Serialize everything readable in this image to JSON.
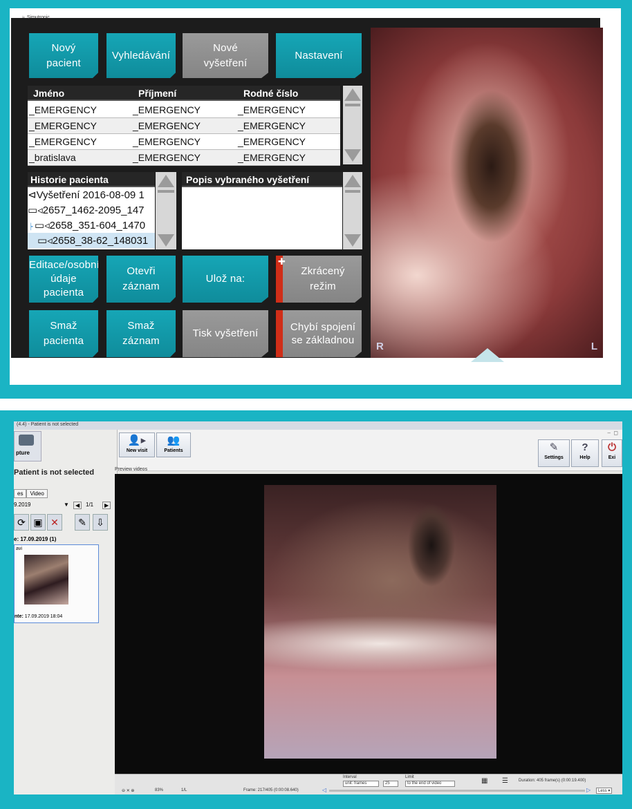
{
  "panel1": {
    "window_title": "Simutronic",
    "buttons": {
      "new_patient": "Nový pacient",
      "search": "Vyhledávání",
      "new_exam": "Nové vyšetření",
      "settings": "Nastavení",
      "edit_patient": "Editace/osobní údaje pacienta",
      "open_record": "Otevři záznam",
      "save_to": "Ulož na:",
      "short_mode": "Zkrácený režim",
      "delete_patient": "Smaž pacienta",
      "delete_record": "Smaž záznam",
      "print_exam": "Tisk vyšetření",
      "no_connection": "Chybí spojení se základnou"
    },
    "table": {
      "columns": [
        "Jméno",
        "Příjmení",
        "Rodné číslo"
      ],
      "rows": [
        [
          "_EMERGENCY",
          "_EMERGENCY",
          "_EMERGENCY"
        ],
        [
          "_EMERGENCY",
          "_EMERGENCY",
          "_EMERGENCY"
        ],
        [
          "_EMERGENCY",
          "_EMERGENCY",
          "_EMERGENCY"
        ],
        [
          "_bratislava",
          "_EMERGENCY",
          "_EMERGENCY"
        ]
      ]
    },
    "history": {
      "header": "Historie pacienta",
      "items": [
        "Vyšetření 2016-08-09 1",
        "2657_1462-2095_147",
        "2658_351-604_1470",
        "2658_38-62_148031"
      ]
    },
    "description": {
      "header": "Popis vybraného vyšetření"
    },
    "video_labels": {
      "left": "R",
      "right": "L"
    }
  },
  "panel2": {
    "title_bar": "(4.4) - Patient is not selected",
    "capture_label": "pture",
    "patient_status": "Patient is not selected",
    "tabs": [
      "es",
      "Video"
    ],
    "date_value": "9.2019",
    "page": "1/1",
    "date_header": "e: 17.09.2019 (1)",
    "thumb_label": "avi",
    "thumb_date_label": "nte:",
    "thumb_date_value": "17.09.2019 18:04",
    "toolbar": {
      "new_visit": "New visit",
      "patients": "Patients",
      "settings": "Settings",
      "help": "Help",
      "exit": "Exi"
    },
    "preview_label": "Preview videos",
    "bottom": {
      "interval_label": "Interval",
      "interval_value": "unit: frames",
      "interval_num": "25",
      "limit_label": "Limit",
      "limit_value": "to the end of video",
      "duration": "Duration: 405 frame(s) (0:00:19.400)",
      "frame": "Frame: 217/405 (0:00:08.640)",
      "zoom": "83%",
      "ratio": "1/L",
      "less": "Less"
    }
  }
}
